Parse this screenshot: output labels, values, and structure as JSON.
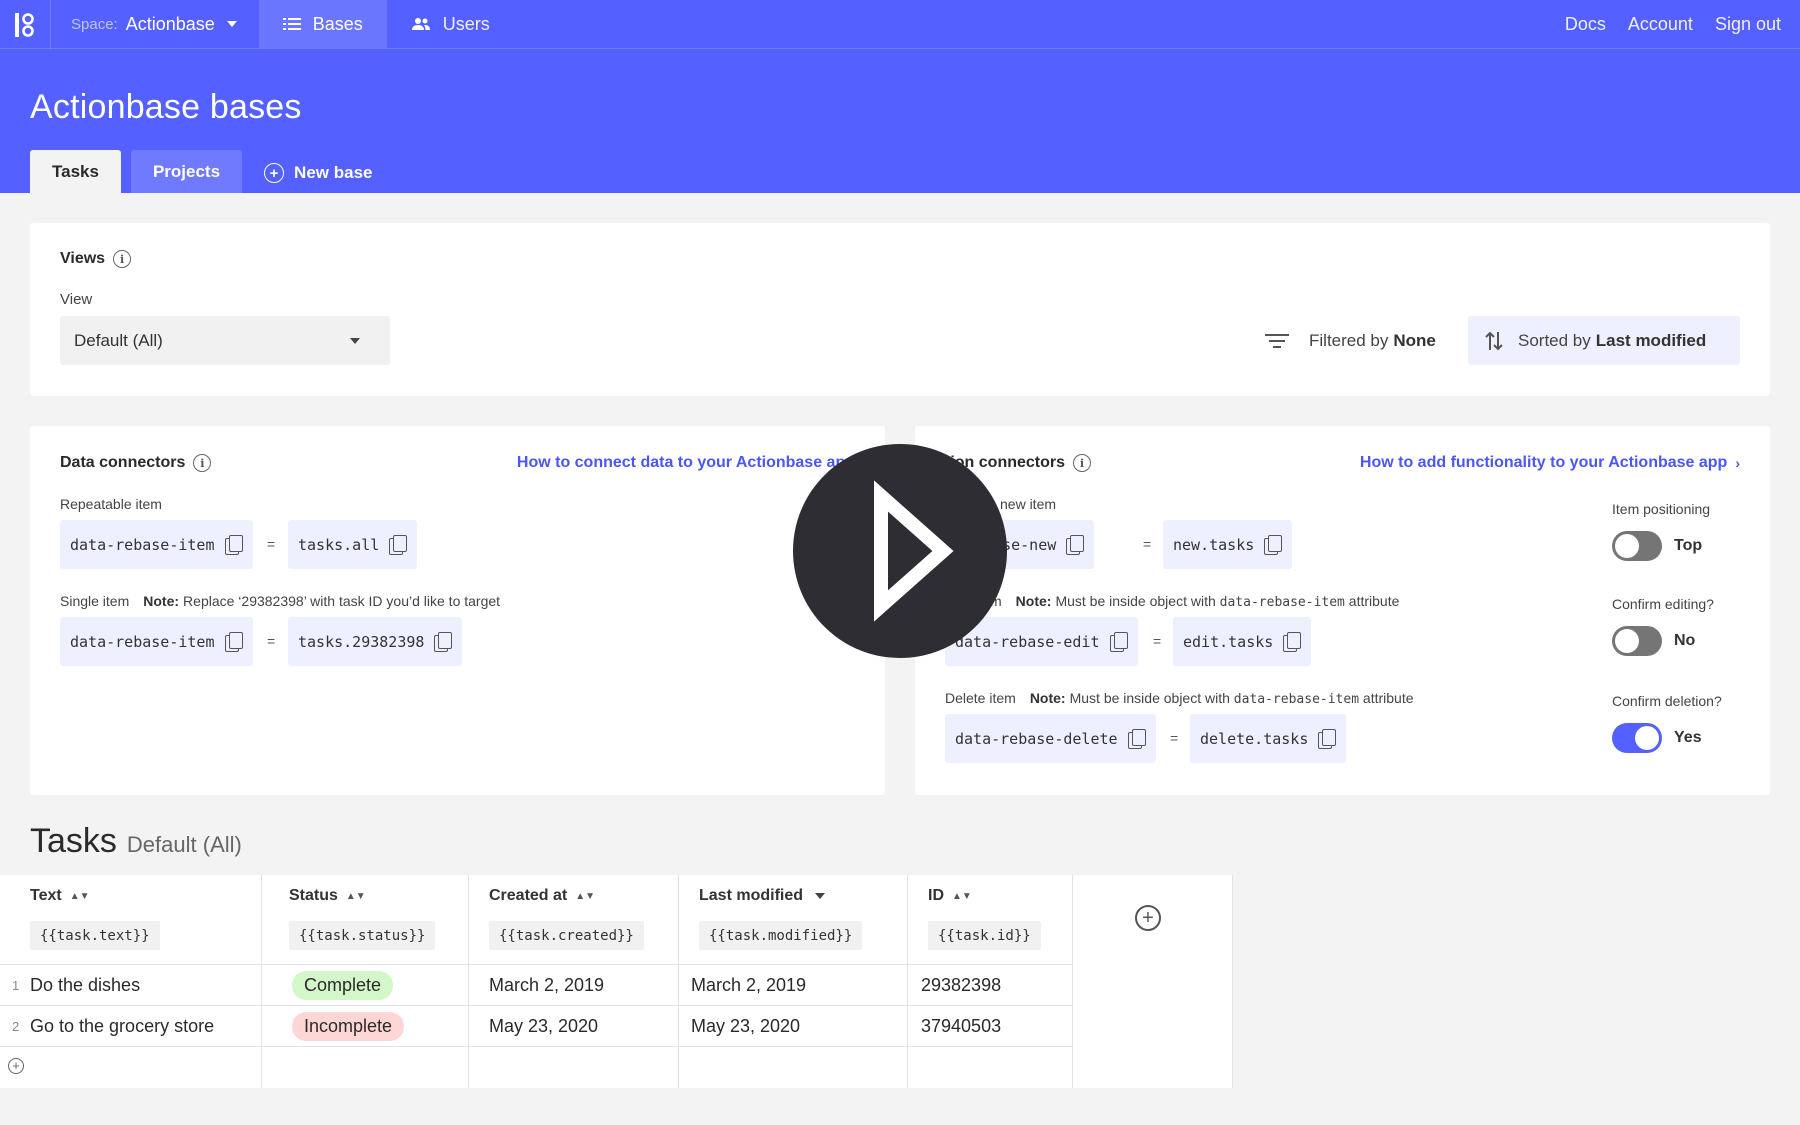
{
  "nav": {
    "space_label": "Space:",
    "space_value": "Actionbase",
    "tabs": [
      {
        "label": "Bases",
        "icon": "list-icon",
        "active": true
      },
      {
        "label": "Users",
        "icon": "users-icon",
        "active": false
      }
    ],
    "right_links": [
      "Docs",
      "Account",
      "Sign out"
    ]
  },
  "header": {
    "title": "Actionbase bases",
    "tabs": [
      "Tasks",
      "Projects"
    ],
    "new_base_label": "New base"
  },
  "views": {
    "title": "Views",
    "view_label": "View",
    "selected_view": "Default (All)",
    "filter_prefix": "Filtered by",
    "filter_value": "None",
    "sort_prefix": "Sorted by",
    "sort_value": "Last modified"
  },
  "data_connectors": {
    "title": "Data connectors",
    "help_link": "How to connect data to your Actionbase app",
    "repeatable_label": "Repeatable item",
    "repeatable_attr": "data-rebase-item",
    "repeatable_value": "tasks.all",
    "single_label": "Single item",
    "single_note_prefix": "Note:",
    "single_note": "Replace ‘29382398’ with task ID you’d like to target",
    "single_attr": "data-rebase-item",
    "single_value": "tasks.29382398",
    "equals": "="
  },
  "action_connectors": {
    "title": "tion connectors",
    "help_link": "How to add functionality to your Actionbase app",
    "new_label": "new item",
    "new_attr": "ebase-new",
    "new_value": "new.tasks",
    "edit_label": "m",
    "edit_note_prefix": "Note:",
    "edit_note_a": "Must be inside object with",
    "edit_note_code": "data-rebase-item",
    "edit_note_b": "attribute",
    "edit_attr": "data-rebase-edit",
    "edit_value": "edit.tasks",
    "delete_label": "Delete item",
    "delete_note_prefix": "Note:",
    "delete_note_a": "Must be inside object with",
    "delete_note_code": "data-rebase-item",
    "delete_note_b": "attribute",
    "delete_attr": "data-rebase-delete",
    "delete_value": "delete.tasks",
    "equals": "=",
    "toggles": [
      {
        "label": "Item positioning",
        "value": "Top",
        "on": false
      },
      {
        "label": "Confirm editing?",
        "value": "No",
        "on": false
      },
      {
        "label": "Confirm deletion?",
        "value": "Yes",
        "on": true
      }
    ]
  },
  "tasks": {
    "title": "Tasks",
    "subtitle": "Default (All)",
    "columns": [
      {
        "label": "Text",
        "template": "{{task.text}}"
      },
      {
        "label": "Status",
        "template": "{{task.status}}"
      },
      {
        "label": "Created at",
        "template": "{{task.created}}"
      },
      {
        "label": "Last modified",
        "template": "{{task.modified}}"
      },
      {
        "label": "ID",
        "template": "{{task.id}}"
      }
    ],
    "rows": [
      {
        "num": "1",
        "text": "Do the dishes",
        "status": "Complete",
        "created": "March 2, 2019",
        "modified": "March 2, 2019",
        "id": "29382398"
      },
      {
        "num": "2",
        "text": "Go to the grocery store",
        "status": "Incomplete",
        "created": "May 23, 2020",
        "modified": "May 23, 2020",
        "id": "37940503"
      }
    ]
  },
  "colors": {
    "brand": "#5460ff",
    "link": "#4a57f5",
    "complete_bg": "#d3f7c9",
    "incomplete_bg": "#ffd6d6",
    "play_overlay": "#2d2d33"
  }
}
